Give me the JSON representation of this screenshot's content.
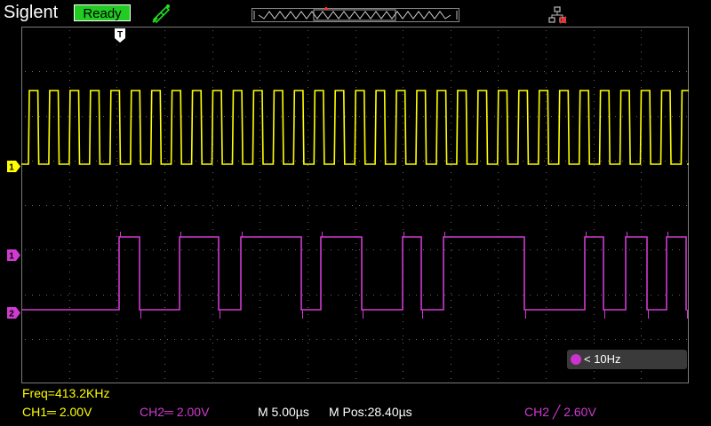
{
  "header": {
    "brand": "Siglent",
    "status": "Ready",
    "trigger_marker": "T"
  },
  "channels": {
    "ch1": {
      "marker": "1",
      "color": "#ffff00"
    },
    "ch2": {
      "marker": "2",
      "color": "#d03ad0"
    },
    "math": {
      "marker": "1",
      "color": "#d03ad0"
    }
  },
  "counter": {
    "text": "< 10Hz"
  },
  "footer": {
    "freq": "Freq=413.2KHz",
    "ch1": "CH1═ 2.00V",
    "ch2": "CH2═ 2.00V",
    "timebase": "M 5.00µs",
    "mpos": "M Pos:28.40µs",
    "trigger": "CH2 ╱ 2.60V"
  },
  "icons": {
    "probe": "probe-icon",
    "memory": "memory-depth-icon",
    "network": "network-icon",
    "counter": "counter-icon"
  }
}
